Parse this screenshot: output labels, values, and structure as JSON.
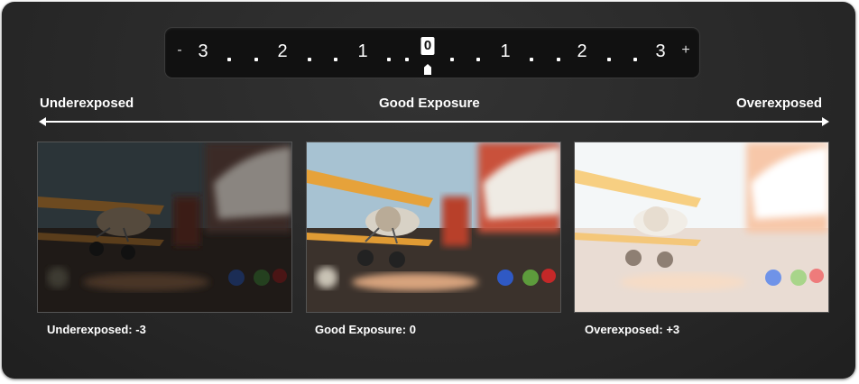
{
  "meter": {
    "minus": "-",
    "plus": "+",
    "marks": [
      "3",
      "2",
      "1",
      "0",
      "1",
      "2",
      "3"
    ]
  },
  "scale": {
    "left_label": "Underexposed",
    "center_label": "Good Exposure",
    "right_label": "Overexposed"
  },
  "photos": [
    {
      "caption": "Underexposed: -3",
      "tone": "dark"
    },
    {
      "caption": "Good Exposure: 0",
      "tone": "normal"
    },
    {
      "caption": "Overexposed: +3",
      "tone": "bright"
    }
  ],
  "colors": {
    "panel": "#2b2b2b",
    "meter": "#111111",
    "text": "#ffffff"
  }
}
